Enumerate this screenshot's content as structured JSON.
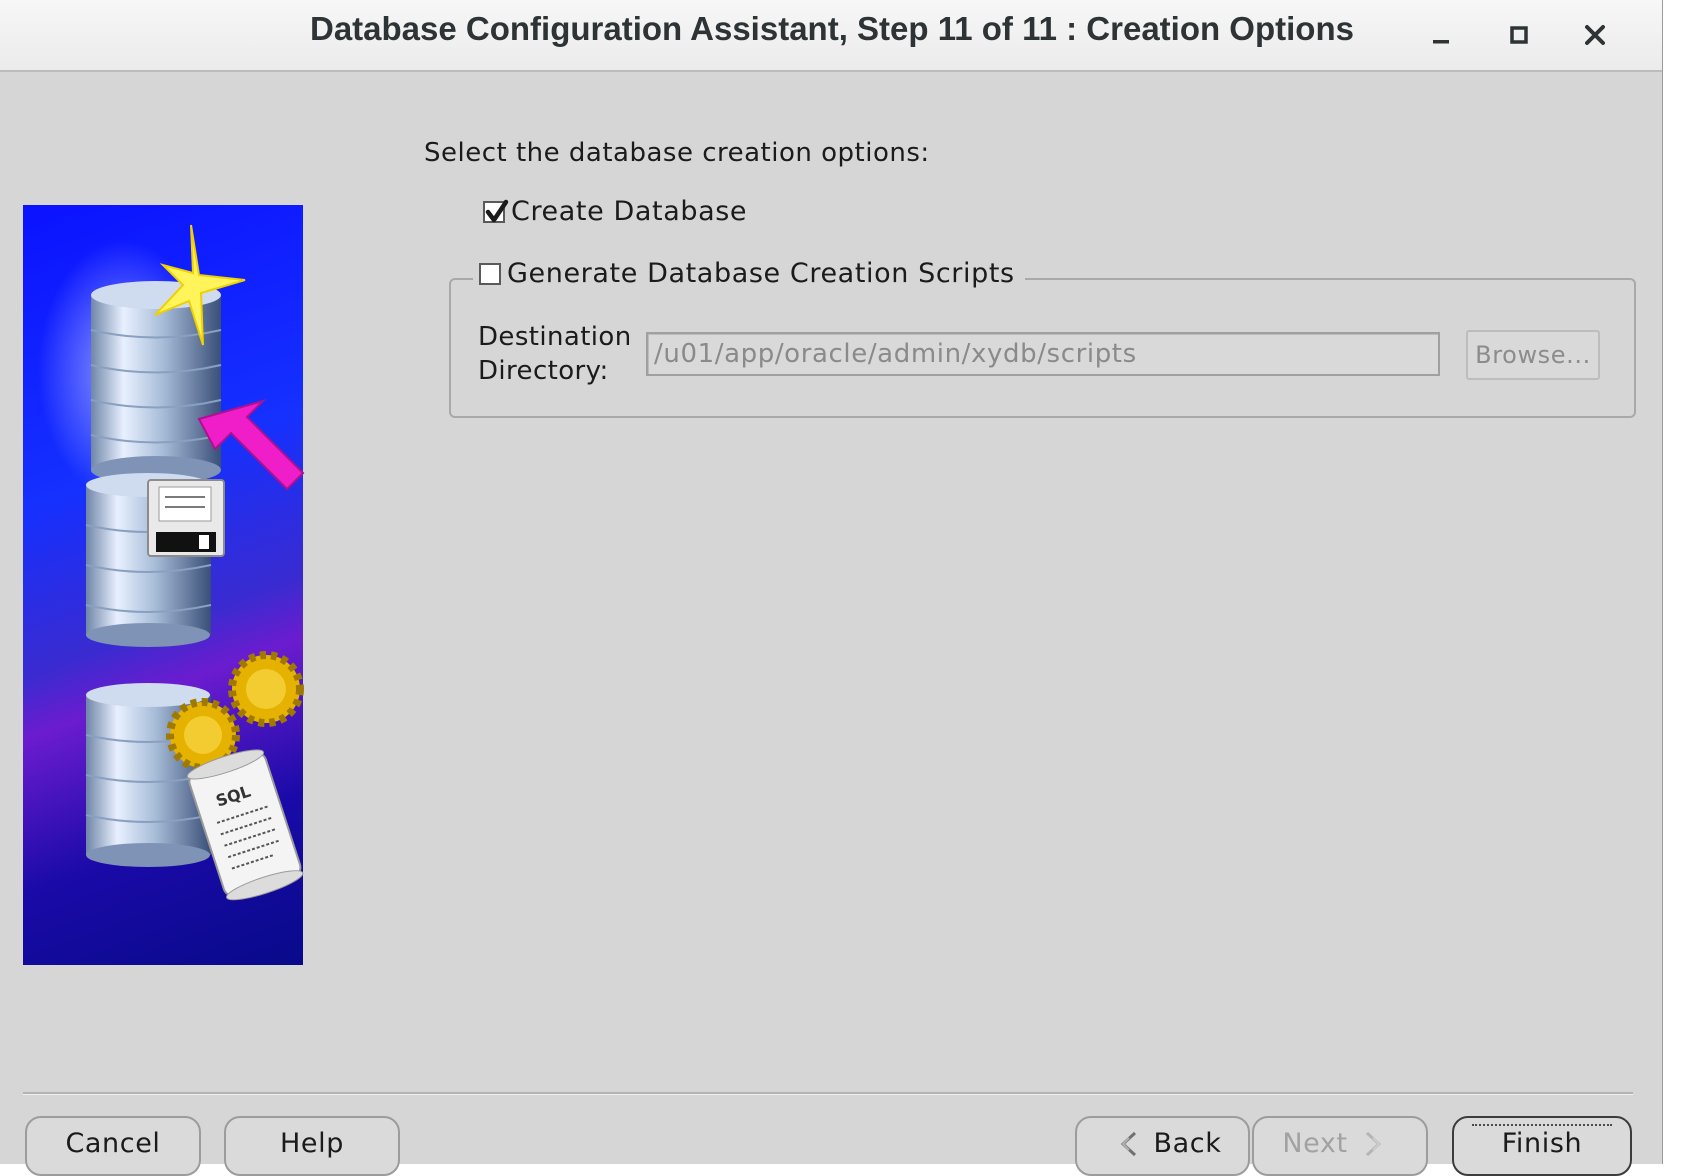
{
  "window": {
    "title": "Database Configuration Assistant, Step 11 of 11 : Creation Options",
    "minimize_icon": "minimize-icon",
    "maximize_icon": "maximize-icon",
    "close_icon": "close-icon"
  },
  "main": {
    "prompt": "Select the database creation options:",
    "create_database": {
      "label": "Create Database",
      "checked": true
    },
    "generate_scripts": {
      "label": "Generate Database Creation Scripts",
      "checked": false
    },
    "destination_label_line1": "Destination",
    "destination_label_line2": "Directory:",
    "destination_value": "/u01/app/oracle/admin/xydb/scripts",
    "browse_label": "Browse..."
  },
  "footer": {
    "cancel_label": "Cancel",
    "help_label": "Help",
    "back_label": "Back",
    "next_label": "Next",
    "finish_label": "Finish"
  },
  "side_art": {
    "icons": [
      "database-create-icon",
      "database-save-icon",
      "database-sql-script-icon"
    ],
    "sql_text": "SQL",
    "colors": {
      "arrow": "#f01ec8",
      "star": "#fff45a",
      "gear": "#e6b200"
    }
  }
}
